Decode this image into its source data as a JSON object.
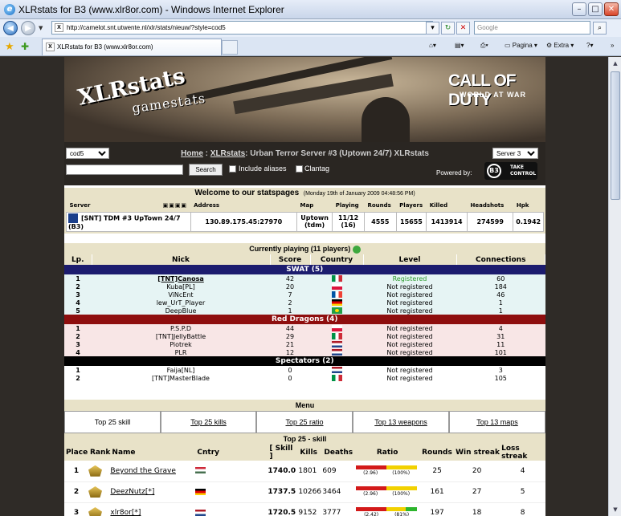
{
  "window": {
    "title": "XLRstats for B3 (www.xlr8or.com) - Windows Internet Explorer"
  },
  "browser": {
    "url": "http://camelot.snt.utwente.nl/xlr/stats/nieuw/?style=cod5",
    "search_placeholder": "Google",
    "tab_title": "XLRstats for B3 (www.xlr8or.com)",
    "cmd_page": "Pagina",
    "cmd_extra": "Extra"
  },
  "banner": {
    "logo_main": "XLRstats",
    "logo_sub": "gamestats",
    "game_title": "CALL OF DUTY",
    "game_sub": "WORLD AT WAR"
  },
  "nav": {
    "style_select": "cod5",
    "breadcrumb_home": "Home",
    "breadcrumb_xlr": "XLRstats",
    "breadcrumb_rest": ": Urban Terror Server #3 (Uptown 24/7) XLRstats",
    "server_select": "Server 3",
    "search_button": "Search",
    "include_aliases": "Include aliases",
    "clantag": "Clantag",
    "powered_by": "Powered by:",
    "b3_text": "TAKE CONTROL",
    "b3_badge": "B3"
  },
  "welcome": {
    "title": "Welcome to our statspages",
    "date": "(Monday 19th of January 2009 04:48:56 PM)",
    "headers": [
      "Server",
      "Address",
      "Map",
      "Playing",
      "Rounds",
      "Players",
      "Killed",
      "Headshots",
      "Hpk"
    ],
    "server": {
      "name": "[SNT] TDM #3 UpTown 24/7 (B3)",
      "address": "130.89.175.45:27970",
      "map": "Uptown (tdm)",
      "playing": "11/12 (16)",
      "rounds": "4555",
      "players": "15655",
      "killed": "1413914",
      "headshots": "274599",
      "hpk": "0.1942"
    }
  },
  "current": {
    "title": "Currently playing (11 players)",
    "headers": [
      "Lp.",
      "Nick",
      "Score",
      "Country",
      "Level",
      "Connections"
    ],
    "teams": [
      {
        "name": "SWAT (5)",
        "color": "#1c1c6e",
        "rowbg": "#e6f4f4",
        "players": [
          {
            "lp": "1",
            "nick": "[TNT]Canosa",
            "score": "42",
            "flag": "it",
            "level": "Registered",
            "conn": "60",
            "bold": true
          },
          {
            "lp": "2",
            "nick": "Kuba[PL]",
            "score": "20",
            "flag": "pl",
            "level": "Not registered",
            "conn": "184"
          },
          {
            "lp": "3",
            "nick": "ViNcEnt",
            "score": "7",
            "flag": "fr",
            "level": "Not registered",
            "conn": "46"
          },
          {
            "lp": "4",
            "nick": "lew_UrT_Player",
            "score": "2",
            "flag": "de",
            "level": "Not registered",
            "conn": "1"
          },
          {
            "lp": "5",
            "nick": "DeepBlue",
            "score": "1",
            "flag": "br",
            "level": "Not registered",
            "conn": "1"
          }
        ]
      },
      {
        "name": "Red Dragons (4)",
        "color": "#8e0e0e",
        "rowbg": "#f8e6e6",
        "players": [
          {
            "lp": "1",
            "nick": "P.S.P.D",
            "score": "44",
            "flag": "pl",
            "level": "Not registered",
            "conn": "4"
          },
          {
            "lp": "2",
            "nick": "[TNT]JellyBattle",
            "score": "29",
            "flag": "it",
            "level": "Not registered",
            "conn": "31"
          },
          {
            "lp": "3",
            "nick": "Piotrek",
            "score": "21",
            "flag": "nl",
            "level": "Not registered",
            "conn": "11"
          },
          {
            "lp": "4",
            "nick": "PLR",
            "score": "12",
            "flag": "nl",
            "level": "Not registered",
            "conn": "101"
          }
        ]
      },
      {
        "name": "Spectators (2)",
        "color": "#000000",
        "rowbg": "#ffffff",
        "players": [
          {
            "lp": "1",
            "nick": "Faija[NL]",
            "score": "0",
            "flag": "nl",
            "level": "Not registered",
            "conn": "3"
          },
          {
            "lp": "2",
            "nick": "[TNT]MasterBlade",
            "score": "0",
            "flag": "it",
            "level": "Not registered",
            "conn": "105"
          }
        ]
      }
    ]
  },
  "menu": {
    "title": "Menu",
    "items": [
      "Top 25 skill",
      "Top 25 kills",
      "Top 25 ratio",
      "Top 13 weapons",
      "Top 13 maps"
    ]
  },
  "top25": {
    "title": "Top 25 - skill",
    "headers": [
      "Place",
      "Rank",
      "Name",
      "Cntry",
      "[ Skill ]",
      "Kills",
      "Deaths",
      "Ratio",
      "Rounds",
      "Win streak",
      "Loss streak"
    ],
    "rows": [
      {
        "place": "1",
        "name": "Beyond the Grave",
        "flag": "hu",
        "skill": "1740.0",
        "kills": "1801",
        "deaths": "609",
        "ratio_a": "(2.96)",
        "ratio_b": "(100%)",
        "ratio_pct": 100,
        "rounds": "25",
        "win": "20",
        "loss": "4"
      },
      {
        "place": "2",
        "name": "DeezNutz[*]",
        "flag": "de",
        "skill": "1737.5",
        "kills": "10266",
        "deaths": "3464",
        "ratio_a": "(2.96)",
        "ratio_b": "(100%)",
        "ratio_pct": 100,
        "rounds": "161",
        "win": "27",
        "loss": "5"
      },
      {
        "place": "3",
        "name": "xlr8or[*]",
        "flag": "nl",
        "skill": "1720.5",
        "kills": "9152",
        "deaths": "3777",
        "ratio_a": "(2.42)",
        "ratio_b": "(81%)",
        "ratio_pct": 81,
        "rounds": "197",
        "win": "18",
        "loss": "8"
      }
    ]
  }
}
